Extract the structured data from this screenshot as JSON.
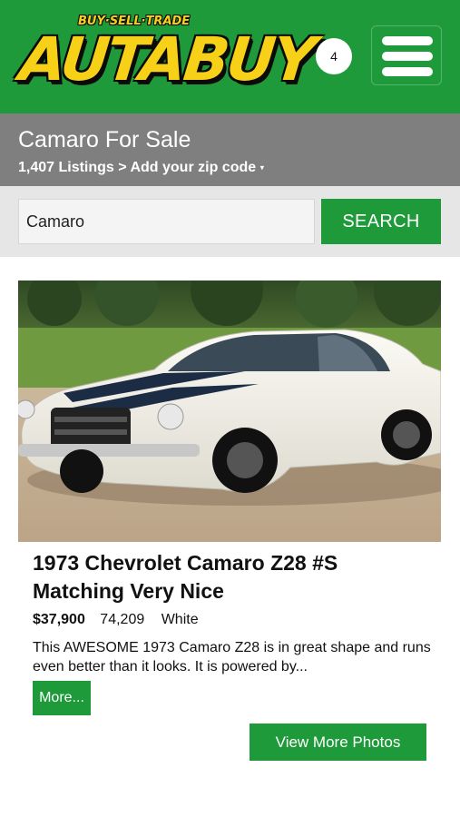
{
  "header": {
    "logo_tagline": "BUY·SELL·TRADE",
    "logo_text": "AUTABUY",
    "badge_count": "4",
    "brand_color": "#1f9a3a",
    "logo_color": "#f7d117",
    "menu_icon": "hamburger-menu-icon"
  },
  "title_band": {
    "title": "Camaro For Sale",
    "listings_text": "1,407 Listings > Add your zip code",
    "caret_glyph": "▾"
  },
  "search": {
    "value": "Camaro",
    "button_label": "SEARCH"
  },
  "listing": {
    "photo_alt": "1973 Chevrolet Camaro Z28 white with dark stripes",
    "title": "1973 Chevrolet Camaro Z28 #S Matching Very Nice",
    "price": "$37,900",
    "mileage": "74,209",
    "color": "White",
    "description": "This AWESOME 1973 Camaro Z28 is in great shape and runs even better than it looks. It is powered by...",
    "more_label": "More...",
    "view_photos_label": "View More Photos"
  }
}
